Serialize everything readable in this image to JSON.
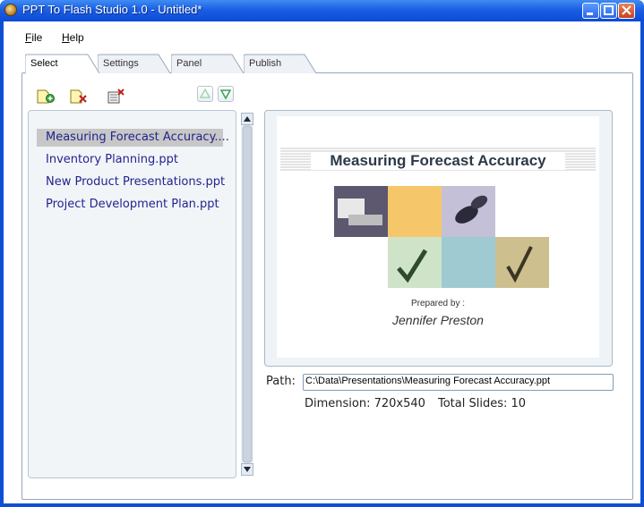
{
  "window": {
    "title": "PPT To Flash Studio 1.0 - Untitled*"
  },
  "menu": {
    "file": "File",
    "file_mnemonic": "F",
    "file_rest": "ile",
    "help": "Help",
    "help_mnemonic": "H",
    "help_rest": "elp"
  },
  "tabs": [
    {
      "label": "Select",
      "active": true
    },
    {
      "label": "Settings",
      "active": false
    },
    {
      "label": "Panel",
      "active": false
    },
    {
      "label": "Publish",
      "active": false
    }
  ],
  "files": [
    {
      "label": "Measuring Forecast Accuracy....",
      "selected": true
    },
    {
      "label": "Inventory Planning.ppt",
      "selected": false
    },
    {
      "label": "New Product Presentations.ppt",
      "selected": false
    },
    {
      "label": "Project Development Plan.ppt",
      "selected": false
    }
  ],
  "slide": {
    "title": "Measuring Forecast Accuracy",
    "prepared_by": "Prepared by :",
    "author": "Jennifer Preston"
  },
  "details": {
    "path_label": "Path:",
    "path_value": "C:\\Data\\Presentations\\Measuring Forecast Accuracy.ppt",
    "dimension": "Dimension: 720x540",
    "total_slides": "Total Slides: 10"
  },
  "colors": {
    "titlebar": "#1b5fe3",
    "selection": "#c7c7c7",
    "file_text": "#23238e",
    "nav_arrow": "#3aa05a"
  }
}
